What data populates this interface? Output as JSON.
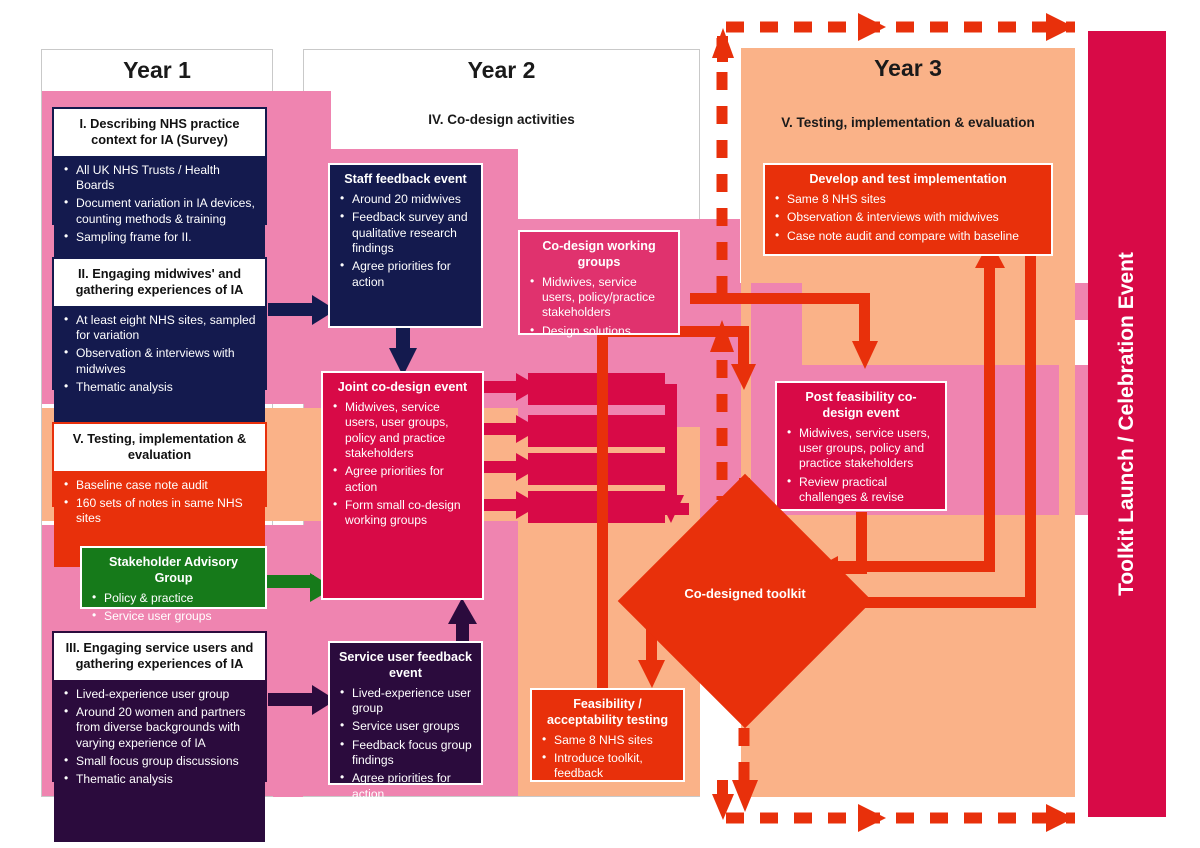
{
  "columns": {
    "year1": {
      "title": "Year 1"
    },
    "year2": {
      "title": "Year 2",
      "section": "IV.  Co-design activities"
    },
    "year3": {
      "title": "Year 3",
      "section": "V.  Testing, implementation & evaluation"
    }
  },
  "banner": {
    "label": "Toolkit Launch / Celebration Event"
  },
  "boxes": {
    "wp1": {
      "heading": "I.  Describing NHS practice context for IA (Survey)",
      "items": [
        "All UK NHS Trusts / Health Boards",
        "Document variation in IA devices, counting methods & training",
        "Sampling frame for II."
      ]
    },
    "wp2": {
      "heading": "II.  Engaging midwives' and gathering experiences of IA",
      "items": [
        "At least eight NHS sites, sampled for variation",
        "Observation & interviews with midwives",
        "Thematic analysis"
      ]
    },
    "wp5_baseline": {
      "heading": "V.  Testing, implementation & evaluation",
      "items": [
        "Baseline case note audit",
        "160 sets of notes in same NHS sites"
      ]
    },
    "sag": {
      "heading": "Stakeholder Advisory Group",
      "items": [
        "Policy & practice",
        "Service user groups"
      ]
    },
    "wp3": {
      "heading": "III.  Engaging service users and gathering experiences of IA",
      "items": [
        "Lived-experience user group",
        "Around 20 women and partners from diverse backgrounds with varying experience of IA",
        "Small focus group discussions",
        "Thematic analysis"
      ]
    },
    "staff_feedback": {
      "heading": "Staff feedback event",
      "items": [
        "Around 20 midwives",
        "Feedback survey and qualitative research findings",
        "Agree priorities for action"
      ]
    },
    "joint_codesign": {
      "heading": "Joint co-design event",
      "items": [
        "Midwives, service users, user groups, policy and practice stakeholders",
        "Agree priorities for action",
        "Form small co-design working groups"
      ]
    },
    "service_user_feedback": {
      "heading": "Service user feedback event",
      "items": [
        "Lived-experience user group",
        "Service user groups",
        "Feedback focus group findings",
        "Agree priorities for action"
      ]
    },
    "working_groups": {
      "heading": "Co-design working groups",
      "items": [
        "Midwives, service users, policy/practice stakeholders",
        "Design solutions"
      ]
    },
    "feasibility": {
      "heading": "Feasibility / acceptability testing",
      "items": [
        "Same 8 NHS sites",
        "Introduce toolkit, feedback"
      ]
    },
    "develop_test": {
      "heading": "Develop and test implementation",
      "items": [
        "Same 8 NHS sites",
        "Observation & interviews with midwives",
        "Case note audit and compare with baseline"
      ]
    },
    "post_feasibility": {
      "heading": "Post feasibility co-design event",
      "items": [
        "Midwives, service users, user groups, policy and practice stakeholders",
        "Review practical challenges & revise"
      ]
    },
    "toolkit": {
      "label": "Co-designed toolkit"
    }
  },
  "colors": {
    "navy": "#141a4e",
    "purple": "#2b0b3d",
    "red": "#e8300b",
    "crimson": "#d80a47",
    "magenta": "#e0326e",
    "green": "#167a1a",
    "pink_band": "#ef84b0",
    "peach_band": "#fab288",
    "white": "#ffffff"
  }
}
